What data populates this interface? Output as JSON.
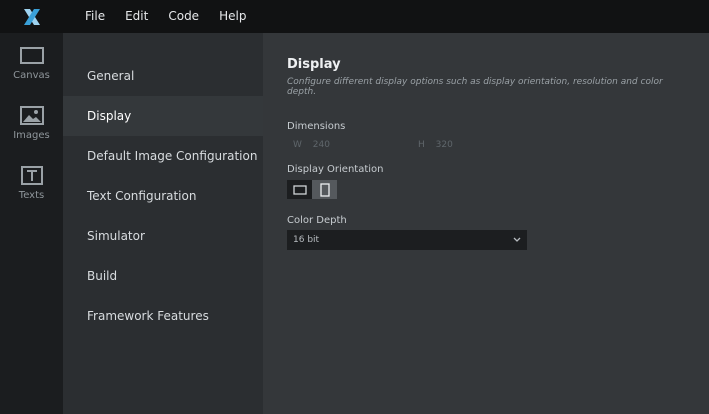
{
  "menu": [
    "File",
    "Edit",
    "Code",
    "Help"
  ],
  "rail": [
    {
      "label": "Canvas",
      "icon": "canvas-icon"
    },
    {
      "label": "Images",
      "icon": "image-icon"
    },
    {
      "label": "Texts",
      "icon": "text-icon"
    }
  ],
  "settings_nav": [
    "General",
    "Display",
    "Default Image Configuration",
    "Text Configuration",
    "Simulator",
    "Build",
    "Framework Features"
  ],
  "active_nav_index": 1,
  "display": {
    "title": "Display",
    "description": "Configure different display options such as display orientation, resolution and color depth.",
    "dimensions_label": "Dimensions",
    "width_key": "W",
    "width_value": "240",
    "height_key": "H",
    "height_value": "320",
    "orientation_label": "Display Orientation",
    "orientation_selected": "portrait",
    "color_depth_label": "Color Depth",
    "color_depth_value": "16 bit"
  },
  "colors": {
    "accent": "#3aa0d8"
  }
}
